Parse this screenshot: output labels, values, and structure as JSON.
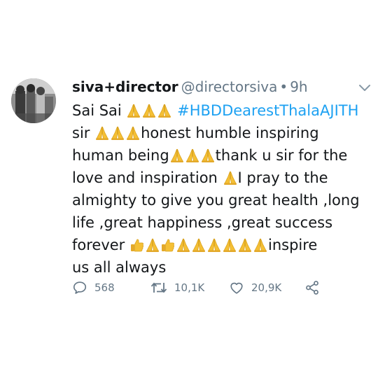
{
  "tweet": {
    "author_name": "siva+director",
    "author_handle": "@directorsiva",
    "separator": "•",
    "time": "9h",
    "lines": [
      [
        {
          "t": "Sai Sai "
        },
        {
          "e": "pray"
        },
        {
          "e": "pray"
        },
        {
          "e": "pray"
        },
        {
          "t": " "
        },
        {
          "h": "#HBDDearestThalaAJITH"
        }
      ],
      [
        {
          "t": "sir "
        },
        {
          "e": "pray"
        },
        {
          "e": "pray"
        },
        {
          "e": "pray"
        },
        {
          "t": "honest humble inspiring"
        }
      ],
      [
        {
          "t": "human being"
        },
        {
          "e": "pray"
        },
        {
          "e": "pray"
        },
        {
          "e": "pray"
        },
        {
          "t": "thank u sir for the"
        }
      ],
      [
        {
          "t": "love and inspiration "
        },
        {
          "e": "pray"
        },
        {
          "t": "I pray to the"
        }
      ],
      [
        {
          "t": "almighty to give you great health ,long"
        }
      ],
      [
        {
          "t": "life ,great happiness ,great success"
        }
      ],
      [
        {
          "t": "forever "
        },
        {
          "e": "thumbsup"
        },
        {
          "e": "pray"
        },
        {
          "e": "thumbsup"
        },
        {
          "e": "pray"
        },
        {
          "e": "pray"
        },
        {
          "e": "pray"
        },
        {
          "e": "pray"
        },
        {
          "e": "pray"
        },
        {
          "e": "pray"
        },
        {
          "t": "inspire"
        }
      ],
      [
        {
          "t": "us all always"
        }
      ]
    ],
    "actions": {
      "replies": "568",
      "retweets": "10,1K",
      "likes": "20,9K"
    }
  },
  "icons": {
    "reply": "reply-icon",
    "retweet": "retweet-icon",
    "like": "heart-icon",
    "share": "share-icon",
    "menu": "chevron-down-icon"
  },
  "colors": {
    "text": "#14171a",
    "muted": "#657786",
    "hashtag": "#1da1f2",
    "emoji": "#f5c035"
  }
}
